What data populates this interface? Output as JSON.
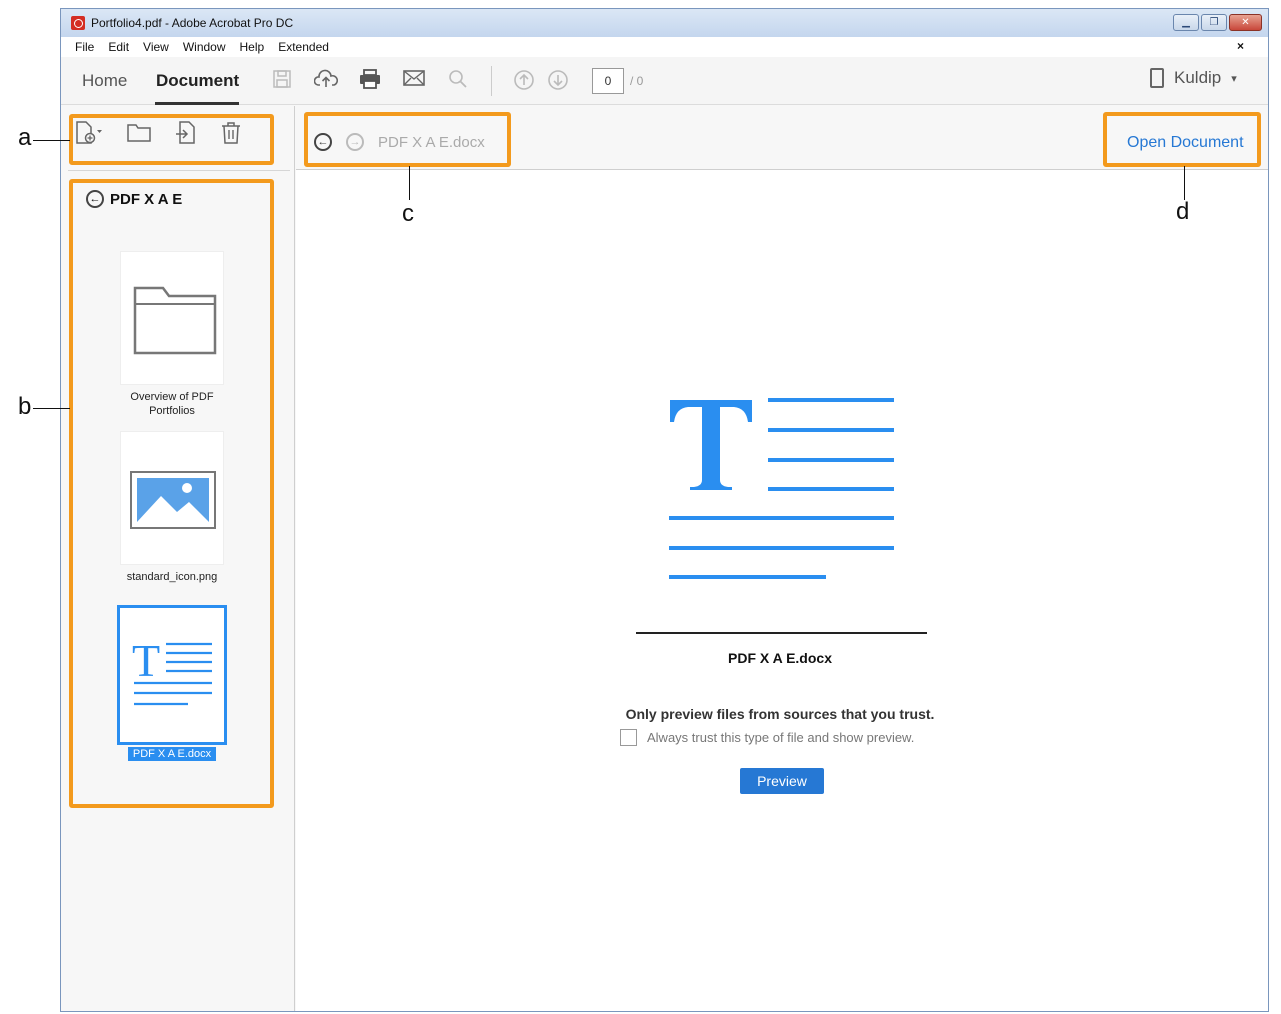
{
  "window": {
    "title": "Portfolio4.pdf - Adobe Acrobat Pro DC",
    "buttons": [
      "minimize",
      "restore",
      "close"
    ]
  },
  "menu": {
    "items": [
      "File",
      "Edit",
      "View",
      "Window",
      "Help",
      "Extended"
    ],
    "close_glyph": "×"
  },
  "toolbar": {
    "tabs": [
      {
        "label": "Home",
        "active": false
      },
      {
        "label": "Document",
        "active": true
      }
    ],
    "icons": [
      "save-icon",
      "upload-cloud-icon",
      "print-icon",
      "email-icon",
      "search-icon",
      "page-up-icon",
      "page-down-icon"
    ],
    "page_current": "0",
    "page_total": "/ 0",
    "user_name": "Kuldip",
    "user_caret": "▾"
  },
  "sidebar": {
    "tools": [
      "add-file-icon",
      "folder-icon",
      "extract-icon",
      "delete-icon"
    ],
    "folder_name": "PDF X A E",
    "items": [
      {
        "label": "Overview of PDF Portfolios",
        "type": "folder",
        "selected": false
      },
      {
        "label": "standard_icon.png",
        "type": "image",
        "selected": false
      },
      {
        "label": "PDF X A E.docx",
        "type": "document",
        "selected": true
      }
    ]
  },
  "main": {
    "breadcrumb": "PDF X A E.docx",
    "open_document_label": "Open Document",
    "doc_name": "PDF X A E.docx",
    "trust_warning": "Only preview files from sources that you trust.",
    "trust_checkbox_label": "Always trust this type of file and show preview.",
    "preview_button_label": "Preview"
  },
  "callouts": {
    "a": "a",
    "b": "b",
    "c": "c",
    "d": "d"
  },
  "colors": {
    "accent": "#2678d4",
    "highlight": "#f39a1d",
    "doc_icon": "#2a8ef0"
  }
}
